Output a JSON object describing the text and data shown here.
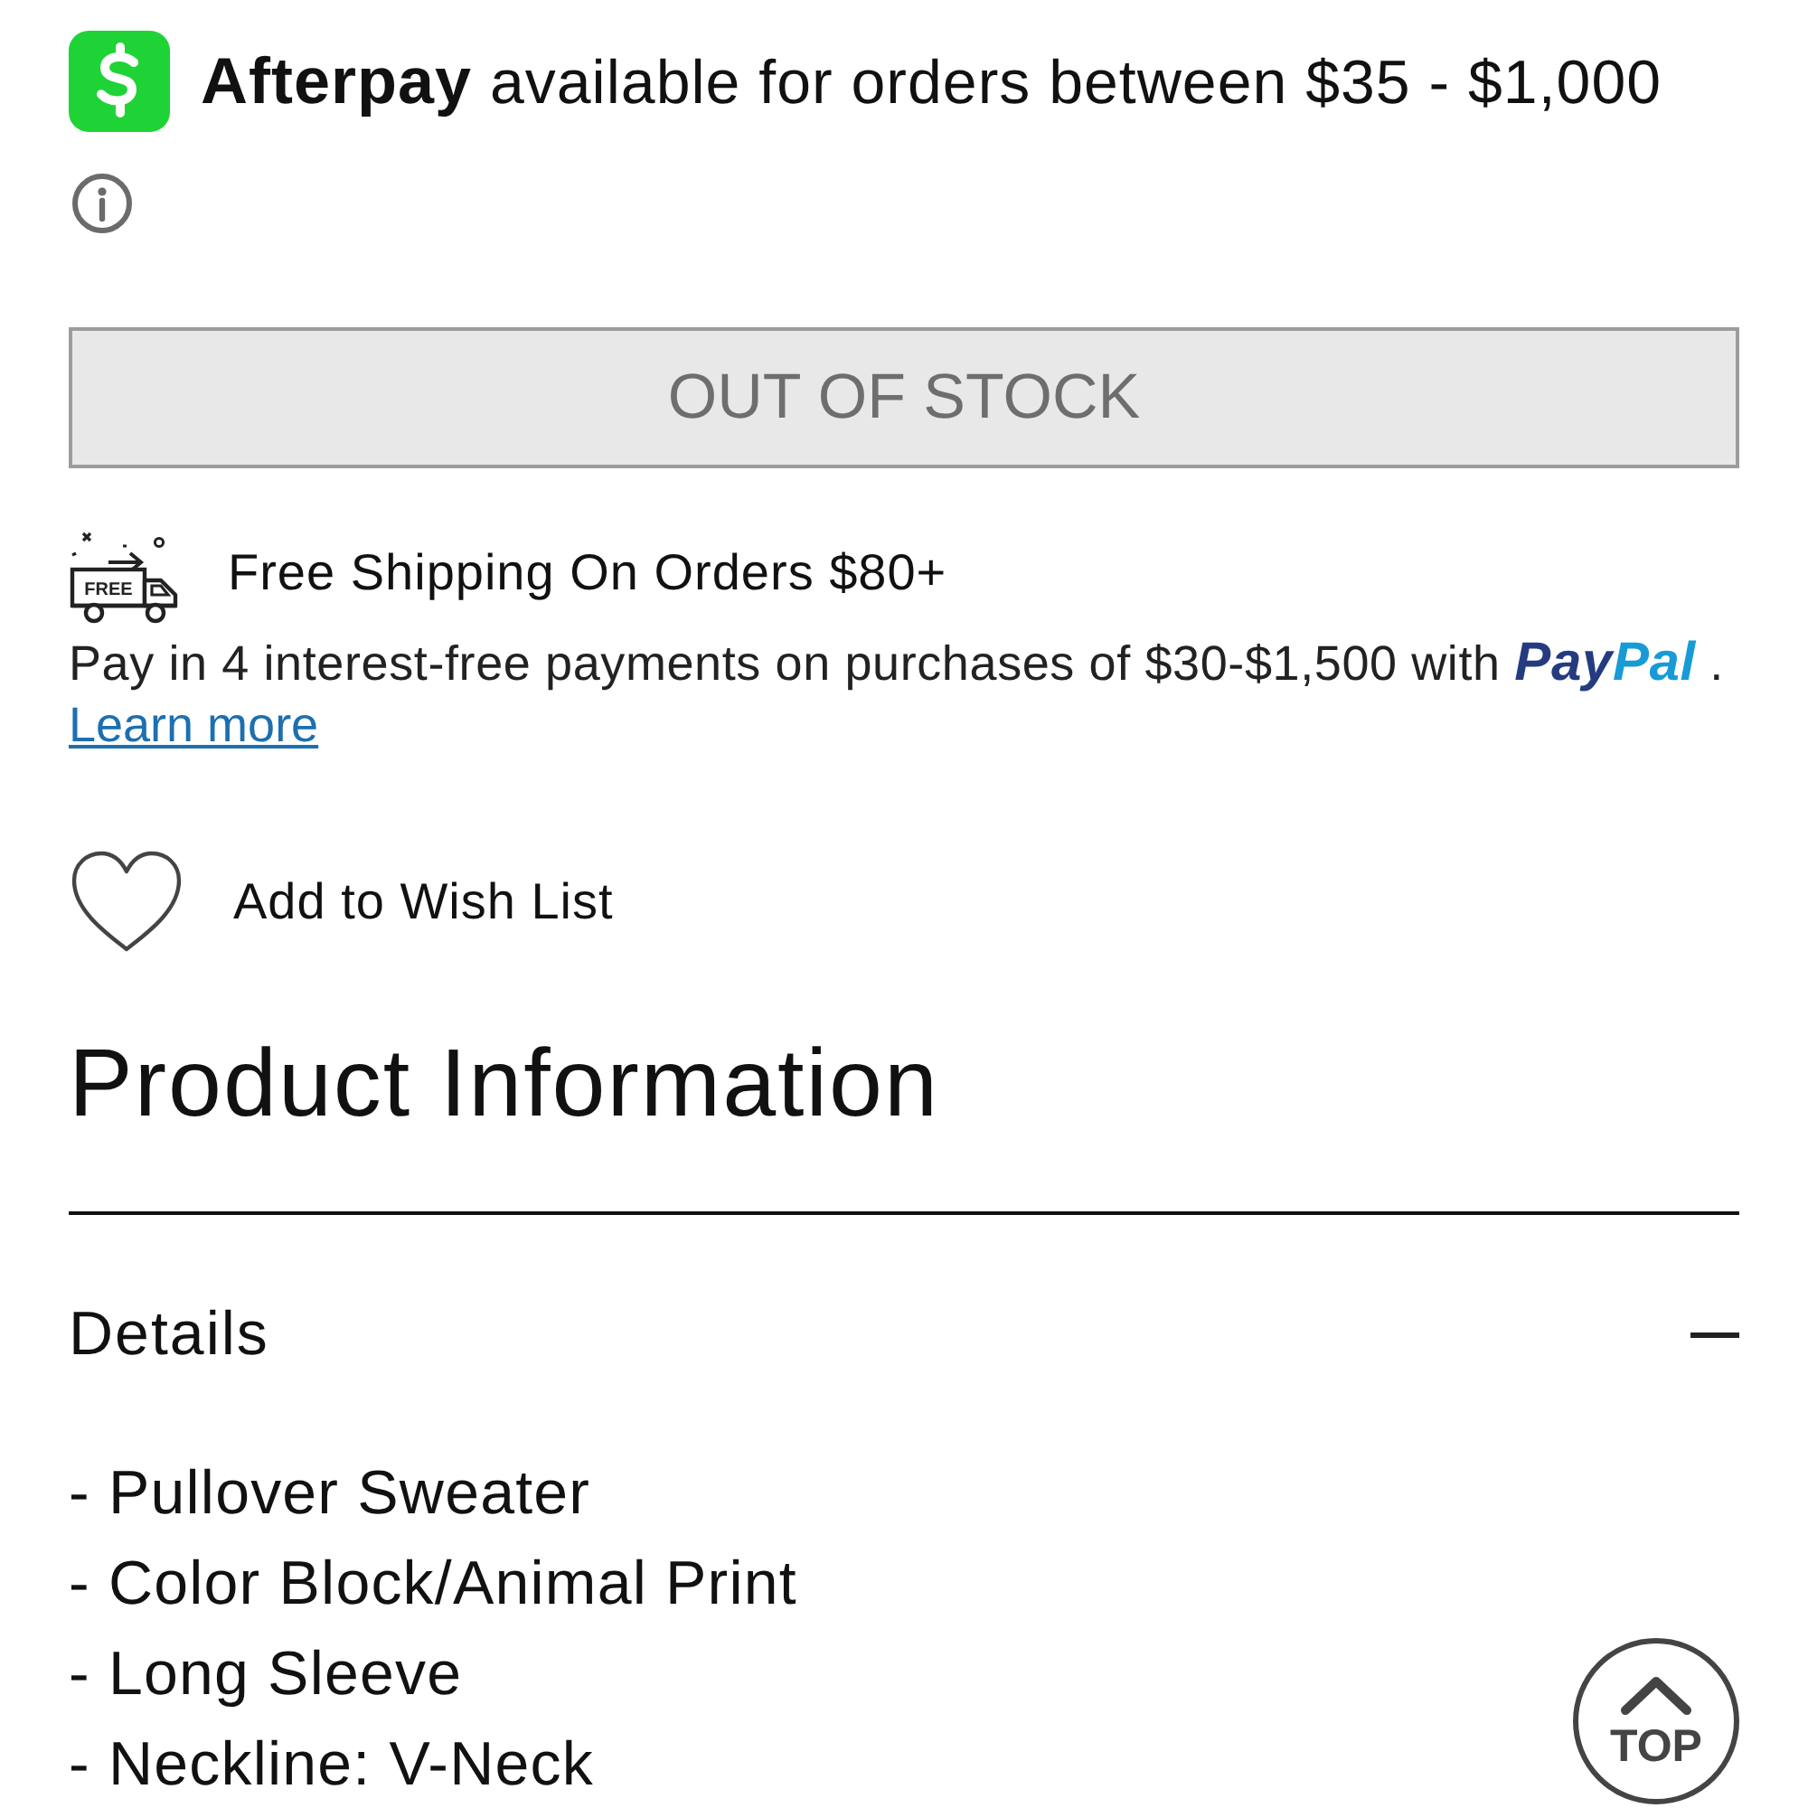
{
  "afterpay": {
    "brand": "Afterpay",
    "text": "available for orders between $35 - $1,000"
  },
  "stock_button": {
    "label": "OUT OF STOCK",
    "disabled": true
  },
  "shipping": {
    "icon_label": "FREE",
    "text": "Free Shipping On Orders $80+"
  },
  "paypal": {
    "text": "Pay in 4 interest-free payments on purchases of $30-$1,500 with",
    "brand_first": "Pay",
    "brand_second": "Pal",
    "end": ".",
    "link": "Learn more"
  },
  "wishlist": {
    "label": "Add to Wish List",
    "saved": false
  },
  "heading": "Product Information",
  "details": {
    "title": "Details",
    "expanded": true,
    "items": [
      "- Pullover Sweater",
      "- Color Block/Animal Print",
      "- Long Sleeve",
      "- Neckline: V-Neck"
    ]
  },
  "top_button": {
    "label": "TOP"
  }
}
